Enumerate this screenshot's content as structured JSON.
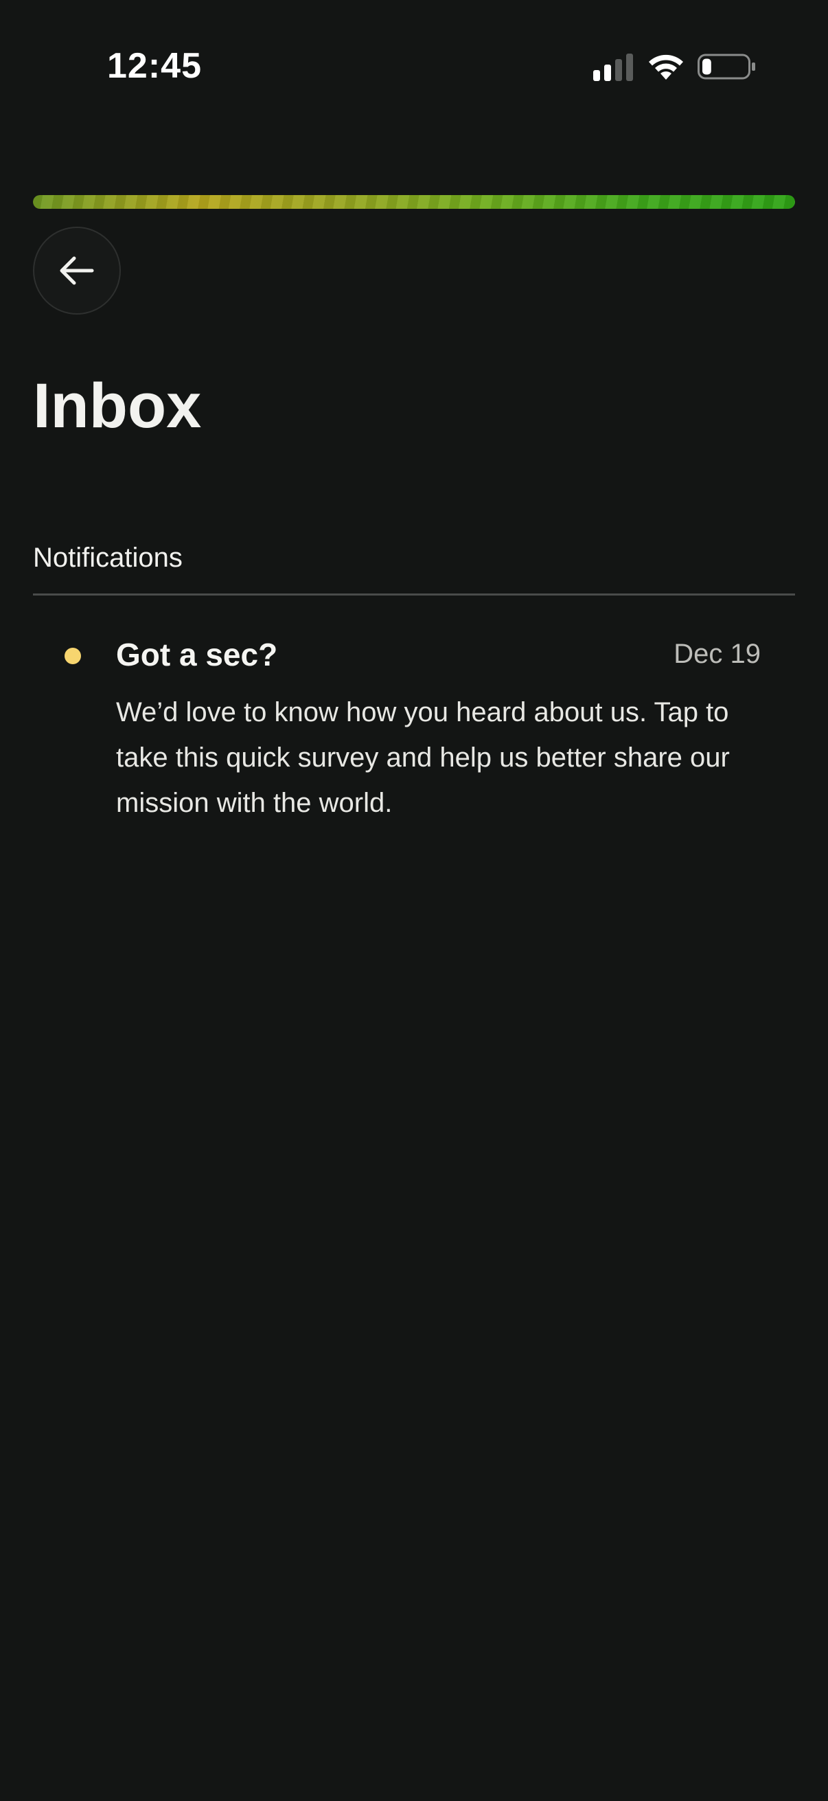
{
  "status_bar": {
    "time": "12:45",
    "icons": [
      "cellular-signal-icon",
      "wifi-icon",
      "battery-icon"
    ],
    "signal_bars_active": 2,
    "battery_level": 0.2
  },
  "progress": {
    "value": 1.0,
    "colors": [
      "#b6a71c",
      "#2fa416"
    ]
  },
  "header": {
    "back_icon": "arrow-left-icon",
    "title": "Inbox"
  },
  "notifications_section": {
    "label": "Notifications",
    "items": [
      {
        "title": "Got a sec?",
        "date": "Dec 19",
        "body": "We’d love to know how you heard about us. Tap to take this quick survey and help us better share our mission with the world.",
        "unread": true,
        "unread_color": "#f7d56f"
      }
    ]
  },
  "theme": {
    "background": "#131514",
    "text": "#f2f2ef",
    "muted_text": "#bdbdb9"
  }
}
